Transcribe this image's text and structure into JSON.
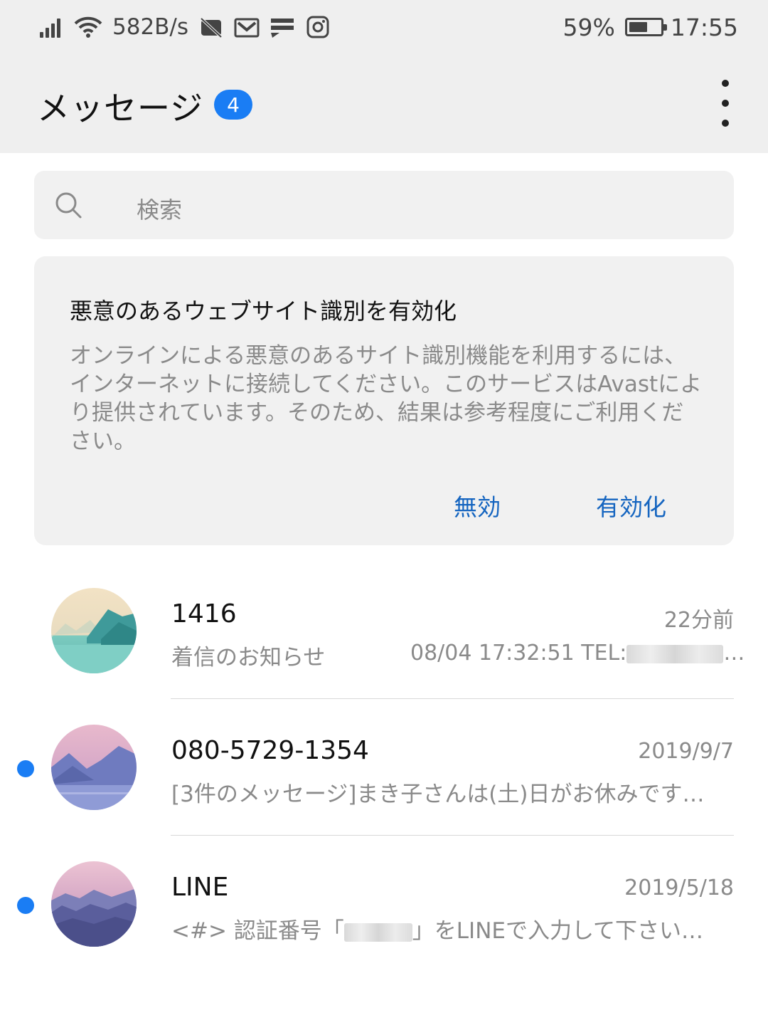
{
  "status_bar": {
    "network_speed": "582B/s",
    "battery_percent": "59%",
    "battery_level": 0.59,
    "time": "17:55",
    "icons": [
      "signal-icon",
      "wifi-icon",
      "notification-muted-icon",
      "mail-icon",
      "chat-icon",
      "instagram-icon",
      "battery-icon"
    ]
  },
  "header": {
    "title": "メッセージ",
    "badge_count": "4",
    "more_icon": "more-vertical-icon"
  },
  "search": {
    "placeholder": "検索",
    "icon": "search-icon"
  },
  "card": {
    "title": "悪意のあるウェブサイト識別を有効化",
    "body": "オンラインによる悪意のあるサイト識別機能を利用するには、インターネットに接続してください。このサービスはAvastにより提供されています。そのため、結果は参考程度にご利用ください。",
    "disable_label": "無効",
    "enable_label": "有効化"
  },
  "accent_color": "#1a7df4",
  "link_color": "#1565c0",
  "messages": [
    {
      "sender": "1416",
      "date": "22分前",
      "preview": "着信のお知らせ",
      "extra": "08/04 17:32:51 TEL:",
      "extra_suffix": "…",
      "unread": false
    },
    {
      "sender": "080-5729-1354",
      "date": "2019/9/7",
      "preview": "[3件のメッセージ]まき子さんは(土)日がお休みです…",
      "unread": true
    },
    {
      "sender": "LINE",
      "date": "2019/5/18",
      "preview_prefix": "<#> 認証番号「",
      "preview_suffix": "」をLINEで入力して下さい…",
      "unread": true
    }
  ]
}
